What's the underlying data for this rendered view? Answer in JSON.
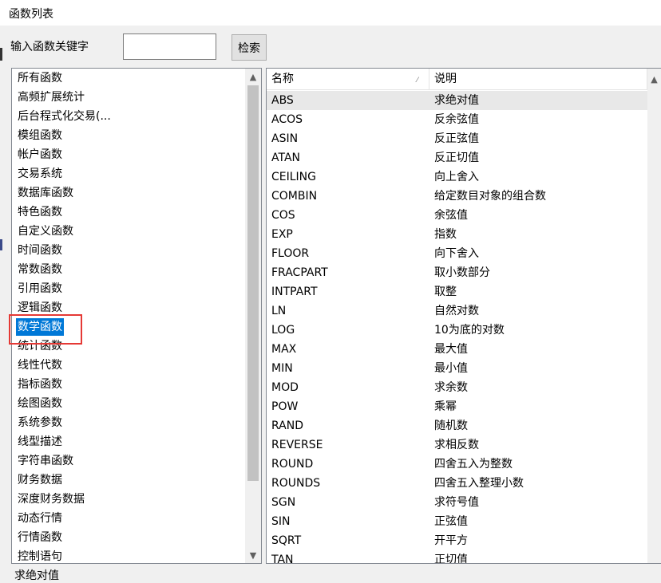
{
  "window": {
    "title": "函数列表"
  },
  "search": {
    "label": "输入函数关键字",
    "value": "",
    "button_label": "检索"
  },
  "categories": [
    "所有函数",
    "高频扩展统计",
    "后台程式化交易(...",
    "模组函数",
    "帐户函数",
    "交易系统",
    "数据库函数",
    "特色函数",
    "自定义函数",
    "时间函数",
    "常数函数",
    "引用函数",
    "逻辑函数",
    "数学函数",
    "统计函数",
    "线性代数",
    "指标函数",
    "绘图函数",
    "系统参数",
    "线型描述",
    "字符串函数",
    "财务数据",
    "深度财务数据",
    "动态行情",
    "行情函数",
    "控制语句"
  ],
  "selected_category": "数学函数",
  "table": {
    "headers": {
      "name": "名称",
      "description": "说明"
    },
    "rows": [
      {
        "name": "ABS",
        "desc": "求绝对值"
      },
      {
        "name": "ACOS",
        "desc": "反余弦值"
      },
      {
        "name": "ASIN",
        "desc": "反正弦值"
      },
      {
        "name": "ATAN",
        "desc": "反正切值"
      },
      {
        "name": "CEILING",
        "desc": "向上舍入"
      },
      {
        "name": "COMBIN",
        "desc": "给定数目对象的组合数"
      },
      {
        "name": "COS",
        "desc": "余弦值"
      },
      {
        "name": "EXP",
        "desc": "指数"
      },
      {
        "name": "FLOOR",
        "desc": "向下舍入"
      },
      {
        "name": "FRACPART",
        "desc": "取小数部分"
      },
      {
        "name": "INTPART",
        "desc": "取整"
      },
      {
        "name": "LN",
        "desc": "自然对数"
      },
      {
        "name": "LOG",
        "desc": "10为底的对数"
      },
      {
        "name": "MAX",
        "desc": "最大值"
      },
      {
        "name": "MIN",
        "desc": "最小值"
      },
      {
        "name": "MOD",
        "desc": "求余数"
      },
      {
        "name": "POW",
        "desc": "乘幂"
      },
      {
        "name": "RAND",
        "desc": "随机数"
      },
      {
        "name": "REVERSE",
        "desc": "求相反数"
      },
      {
        "name": "ROUND",
        "desc": "四舍五入为整数"
      },
      {
        "name": "ROUNDS",
        "desc": "四舍五入整理小数"
      },
      {
        "name": "SGN",
        "desc": "求符号值"
      },
      {
        "name": "SIN",
        "desc": "正弦值"
      },
      {
        "name": "SQRT",
        "desc": "开平方"
      },
      {
        "name": "TAN",
        "desc": "正切值"
      }
    ]
  },
  "bottom": {
    "description": "求绝对值"
  },
  "colors": {
    "selection": "#0078d7",
    "highlight_box": "#e53935"
  },
  "icons": {
    "sort": "triangle-up-glyph",
    "scroll_up": "chevron-up-glyph",
    "scroll_down": "chevron-down-glyph"
  }
}
